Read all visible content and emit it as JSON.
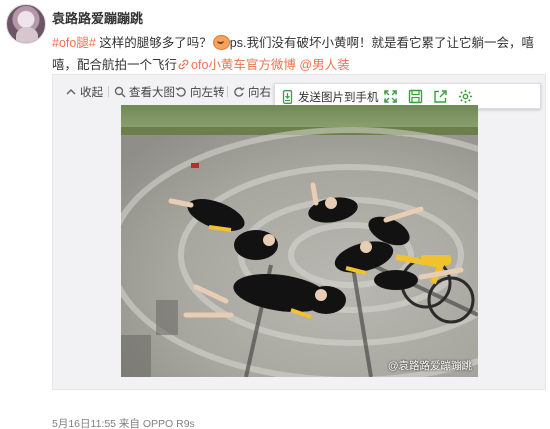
{
  "post": {
    "username": "袁路路爱蹦蹦跳",
    "hashtag": "#ofo腿#",
    "text_1": " 这样的腿够多了吗？",
    "text_2": "ps.我们没有破坏小黄啊！就是看它累了让它躺一会，嘻嘻，配合航拍一个飞行",
    "link_text": "ofo小黄车官方微博",
    "mention": "@男人装",
    "meta": "5月16日11:55 来自 OPPO R9s"
  },
  "toolbar": {
    "collapse": "收起",
    "view_large": "查看大图",
    "rotate_left": "向左转",
    "rotate_right": "向右",
    "send_to_phone": "发送图片到手机"
  },
  "photo": {
    "watermark": "@袁路路爱蹦蹦跳"
  },
  "icons": {
    "accent_green": "#3a9f3f",
    "link_orange": "#eb7350"
  }
}
